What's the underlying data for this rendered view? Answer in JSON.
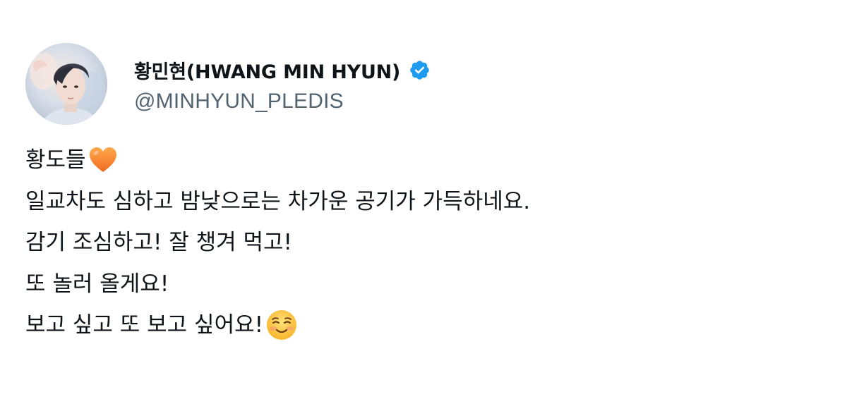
{
  "tweet": {
    "author": {
      "display_name": "황민현(HWANG MIN HYUN)",
      "handle": "@MINHYUN_PLEDIS",
      "verified": true,
      "verified_color": "#1d9bf0",
      "avatar": "profile-photo"
    },
    "lines": [
      {
        "text": "황도들",
        "emoji": "orange-heart-icon"
      },
      {
        "text": "일교차도 심하고 밤낮으로는 차가운 공기가 가득하네요."
      },
      {
        "text": "감기 조심하고! 잘 챙겨 먹고!"
      },
      {
        "text": "또 놀러 올게요!"
      },
      {
        "text": "보고 싶고 또 보고 싶어요!",
        "emoji": "smiling-face-icon"
      }
    ]
  },
  "colors": {
    "text": "#0f1419",
    "secondary_text": "#536471",
    "background": "#ffffff",
    "heart": "#f7842a"
  }
}
